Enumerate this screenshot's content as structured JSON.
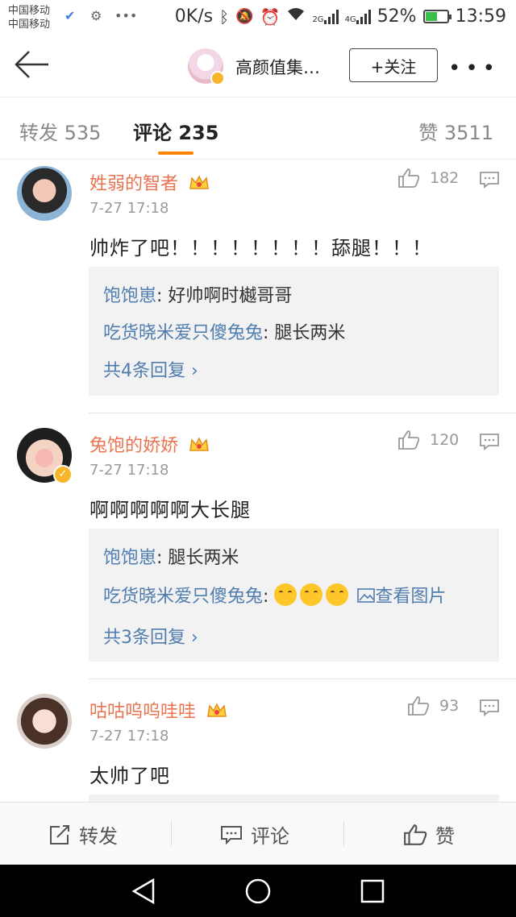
{
  "status_bar": {
    "carrier_1": "中国移动",
    "carrier_2": "中国移动",
    "speed": "0K/s",
    "net_2g": "2G",
    "net_4g": "4G",
    "battery_percent": "52%",
    "battery_level": 0.52,
    "time": "13:59"
  },
  "header": {
    "channel_name": "高颜值集…",
    "follow_label": "+关注"
  },
  "tabs": [
    {
      "label": "转发 535"
    },
    {
      "label": "评论 235"
    },
    {
      "label": "赞 3511"
    }
  ],
  "comments": [
    {
      "user": "姓弱的智者",
      "time": "7-27 17:18",
      "likes": "182",
      "text": "帅炸了吧！！！！！！！！舔腿！！！",
      "replies": [
        {
          "user": "饱饱崽",
          "text": ": 好帅啊时樾哥哥"
        },
        {
          "user": "吃货晓米爱只傻兔兔",
          "text": ": 腿长两米"
        }
      ],
      "more": "共4条回复 ›"
    },
    {
      "user": "兔饱的娇娇",
      "time": "7-27 17:18",
      "likes": "120",
      "text": "啊啊啊啊啊大长腿",
      "replies": [
        {
          "user": "饱饱崽",
          "text": ": 腿长两米"
        },
        {
          "user": "吃货晓米爱只傻兔兔",
          "text": ": ",
          "view_image": "查看图片"
        }
      ],
      "more": "共3条回复 ›"
    },
    {
      "user": "咕咕呜呜哇哇",
      "time": "7-27 17:18",
      "likes": "93",
      "text": "太帅了吧"
    }
  ],
  "actions": {
    "repost": "转发",
    "comment": "评论",
    "like": "赞"
  },
  "colors": {
    "accent": "#ff8200",
    "username": "#eb7350",
    "link": "#507daf"
  }
}
